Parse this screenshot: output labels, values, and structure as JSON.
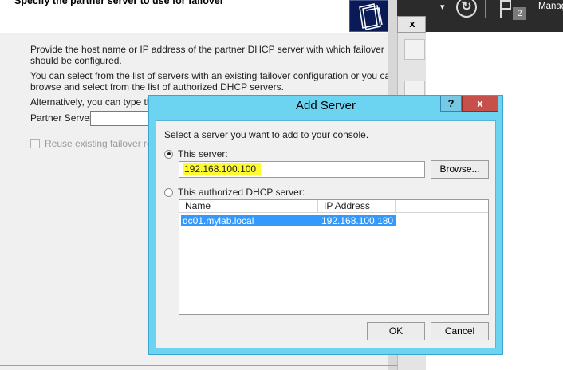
{
  "wizard": {
    "title": "Specify the partner server to use for failover",
    "para1": "Provide the host name or IP address of the partner DHCP server with which failover",
    "para1b": "should be configured.",
    "para2": "You can select from the list of servers with an existing failover configuration or you can",
    "para2b": "browse and select from the list of authorized DHCP servers.",
    "para3": "Alternatively, you can type the h",
    "partner_label": "Partner Server:",
    "reuse_label": "Reuse existing failover relati"
  },
  "server_manager": {
    "dropdown": "▾",
    "notification_count": "2",
    "manage_label": "Manag",
    "close_label": "x"
  },
  "dialog": {
    "title": "Add Server",
    "help_label": "?",
    "close_label": "x",
    "instruction": "Select a server you want to add to your console.",
    "this_server_label": "This server:",
    "this_server_value": "192.168.100.100",
    "browse_label": "Browse...",
    "authorized_label": "This authorized DHCP server:",
    "columns": [
      "Name",
      "IP Address"
    ],
    "rows": [
      {
        "name": "dc01.mylab.local",
        "ip": "192.168.100.180"
      }
    ],
    "ok_label": "OK",
    "cancel_label": "Cancel"
  },
  "colors": {
    "dialog_frame": "#6cd3f1",
    "selection": "#3399ff",
    "highlight": "#fffb2e",
    "close_red": "#c7504a"
  }
}
